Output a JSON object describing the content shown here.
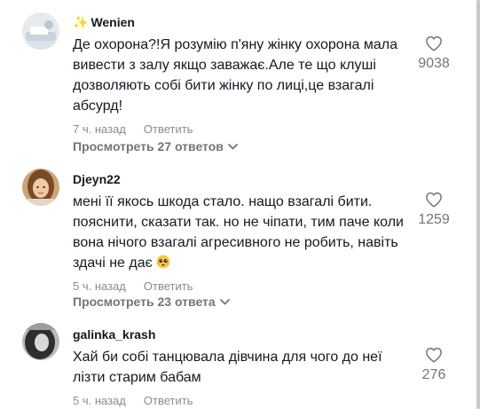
{
  "comments": [
    {
      "username": "Wenien",
      "username_prefix": "✨",
      "text": "Де охорона?!Я розумію п'яну жінку охорона мала вивести з залу якщо заважає.Але те що клуші дозволяють собі бити жінку по лиці,це взагалі абсурд!",
      "time": "7 ч. назад",
      "reply_label": "Ответить",
      "likes": "9038",
      "view_replies": "Просмотреть 27 ответов"
    },
    {
      "username": "Djeyn22",
      "text": "мені її якось шкода стало. нащо взагалі бити. пояснити, сказати так. но не чіпати, тим паче коли вона нічого взагалі агресивного не робить, навіть здачі не дає",
      "emoji": "pleading-face",
      "time": "5 ч. назад",
      "reply_label": "Ответить",
      "likes": "1259",
      "view_replies": "Просмотреть 23 ответа"
    },
    {
      "username": "galinka_krash",
      "text": "Хай би собі танцювала дівчина для чого до неї лізти старим бабам",
      "time": "5 ч. назад",
      "reply_label": "Ответить",
      "likes": "276"
    }
  ],
  "colors": {
    "text": "#161823",
    "secondary": "#8a8b91",
    "view_replies": "#73747b",
    "accent_sparkle": "#e9b93a"
  },
  "icons": {
    "like": "heart-outline-icon",
    "expand": "chevron-down-icon"
  }
}
